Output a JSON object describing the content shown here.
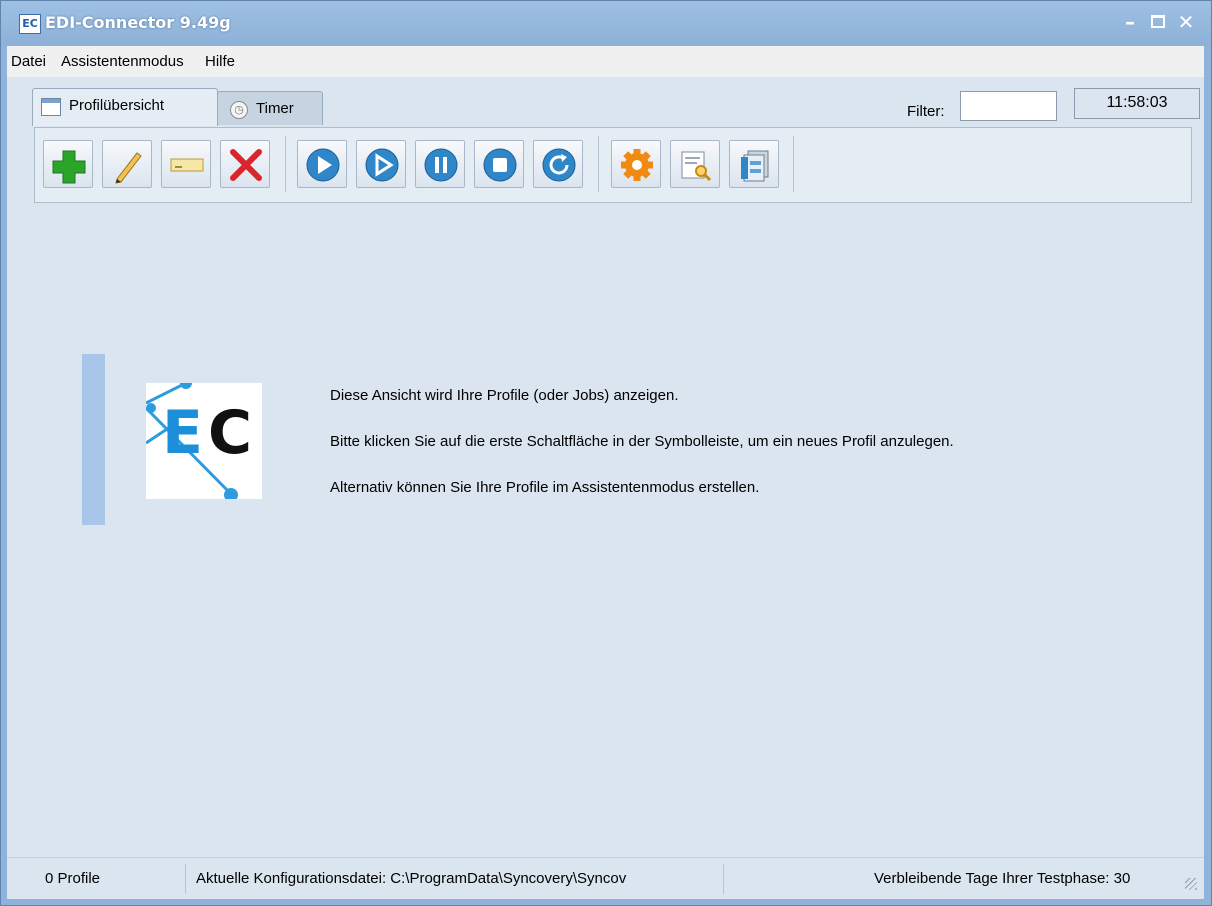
{
  "window": {
    "title": "EDI-Connector 9.49g",
    "app_icon_text": "EC"
  },
  "menu": {
    "items": [
      "Datei",
      "Assistentenmodus",
      "Hilfe"
    ]
  },
  "tabs": [
    {
      "label": "Profilübersicht",
      "active": true
    },
    {
      "label": "Timer",
      "active": false
    }
  ],
  "filter": {
    "label": "Filter:",
    "value": ""
  },
  "clock": "11:58:03",
  "toolbar": {
    "groups": [
      [
        "add-profile",
        "edit-profile",
        "rename-profile",
        "delete-profile"
      ],
      [
        "run",
        "run-attended",
        "pause",
        "stop",
        "restart"
      ],
      [
        "settings",
        "log-viewer",
        "database"
      ]
    ]
  },
  "welcome": {
    "line1": "Diese Ansicht wird Ihre Profile (oder Jobs) anzeigen.",
    "line2": "Bitte klicken Sie auf die erste Schaltfläche in der Symbolleiste, um ein neues Profil anzulegen.",
    "line3": "Alternativ können Sie Ihre Profile im Assistentenmodus erstellen."
  },
  "status": {
    "profiles": "0 Profile",
    "config": "Aktuelle Konfigurationsdatei: C:\\ProgramData\\Syncovery\\Syncov",
    "trial": "Verbleibende Tage Ihrer Testphase: 30"
  },
  "colors": {
    "titlebar": "#8fb3d9",
    "client": "#dae5ef",
    "accent_bar": "#a8c6ea",
    "play_blue": "#2f86c8",
    "add_green": "#2aa52a",
    "delete_red": "#d9262b",
    "gear_orange": "#f08a12"
  }
}
